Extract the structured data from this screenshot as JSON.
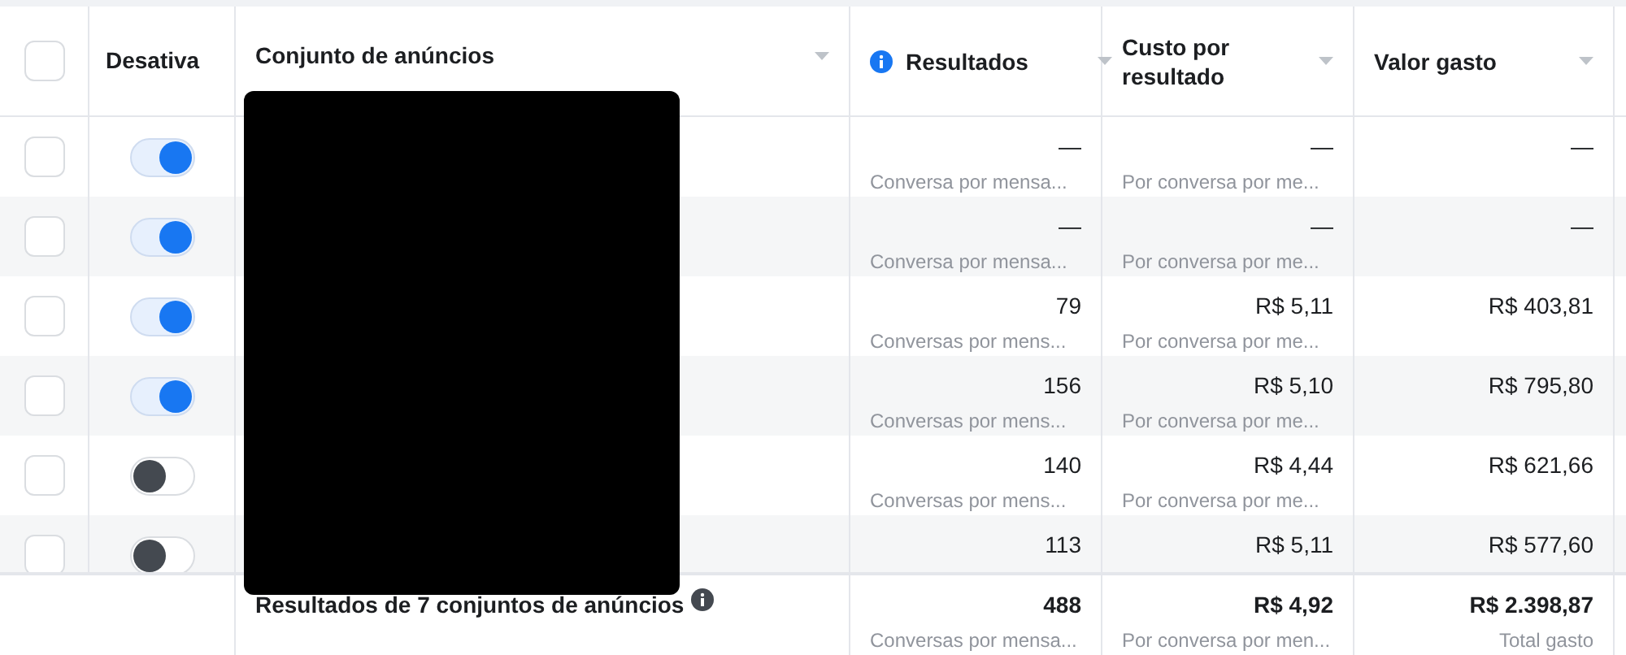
{
  "header_checked": false,
  "columns": [
    {
      "label": "Desativa"
    },
    {
      "label": "Conjunto de anúncios"
    },
    {
      "label": "Resultados",
      "info": true
    },
    {
      "label": "Custo por resultado"
    },
    {
      "label": "Valor gasto"
    }
  ],
  "rows": [
    {
      "checked": false,
      "on": true,
      "results": "—",
      "results_sub": "Conversa por mensa...",
      "cost": "—",
      "cost_sub": "Por conversa por me...",
      "spent": "—"
    },
    {
      "checked": false,
      "on": true,
      "results": "—",
      "results_sub": "Conversa por mensa...",
      "cost": "—",
      "cost_sub": "Por conversa por me...",
      "spent": "—"
    },
    {
      "checked": false,
      "on": true,
      "results": "79",
      "results_sub": "Conversas por mens...",
      "cost": "R$ 5,11",
      "cost_sub": "Por conversa por me...",
      "spent": "R$ 403,81"
    },
    {
      "checked": false,
      "on": true,
      "results": "156",
      "results_sub": "Conversas por mens...",
      "cost": "R$ 5,10",
      "cost_sub": "Por conversa por me...",
      "spent": "R$ 795,80"
    },
    {
      "checked": false,
      "on": false,
      "results": "140",
      "results_sub": "Conversas por mens...",
      "cost": "R$ 4,44",
      "cost_sub": "Por conversa por me...",
      "spent": "R$ 621,66"
    },
    {
      "checked": false,
      "on": false,
      "results": "113",
      "cost": "R$ 5,11",
      "spent": "R$ 577,60"
    }
  ],
  "footer": {
    "label": "Resultados de 7 conjuntos de anúncios",
    "results": "488",
    "results_sub": "Conversas por mensa...",
    "cost": "R$ 4,92",
    "cost_sub": "Por conversa por men...",
    "spent": "R$ 2.398,87",
    "spent_sub": "Total gasto"
  }
}
